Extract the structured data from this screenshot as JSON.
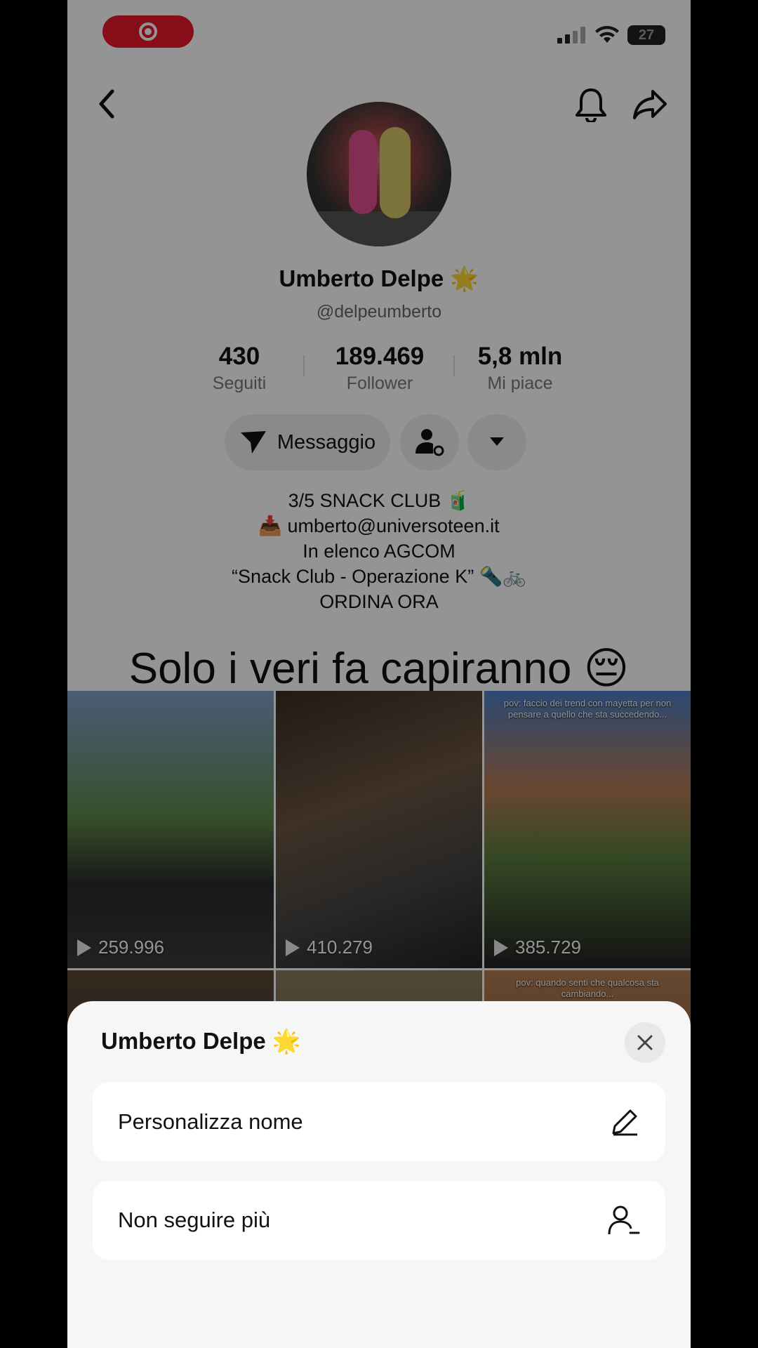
{
  "status_bar": {
    "battery": "27"
  },
  "profile": {
    "name": "Umberto Delpe 🌟",
    "handle": "@delpeumberto",
    "stats": [
      {
        "value": "430",
        "label": "Seguiti"
      },
      {
        "value": "189.469",
        "label": "Follower"
      },
      {
        "value": "5,8 mln",
        "label": "Mi piace"
      }
    ],
    "message_button": "Messaggio",
    "bio": [
      "3/5 SNACK CLUB 🧃",
      "📥 umberto@universoteen.it",
      "In elenco AGCOM",
      "“Snack Club - Operazione K” 🔦🚲",
      "ORDINA ORA"
    ]
  },
  "overlay_caption": "Solo i veri fa capiranno 😔",
  "videos": [
    {
      "views": "259.996",
      "caption": ""
    },
    {
      "views": "410.279",
      "caption": ""
    },
    {
      "views": "385.729",
      "caption": "pov: faccio dei trend con mayetta per non pensare a quello che sta succedendo..."
    },
    {
      "views": "",
      "caption": ""
    },
    {
      "views": "",
      "caption": ""
    },
    {
      "views": "",
      "caption": "pov: quando senti che qualcosa sta cambiando..."
    }
  ],
  "sheet": {
    "title": "Umberto Delpe 🌟",
    "options": [
      {
        "label": "Personalizza nome",
        "icon": "edit-icon"
      },
      {
        "label": "Non seguire più",
        "icon": "unfollow-icon"
      }
    ]
  },
  "colors": {
    "record": "#e8182b",
    "sheet_bg": "#f6f6f6"
  }
}
